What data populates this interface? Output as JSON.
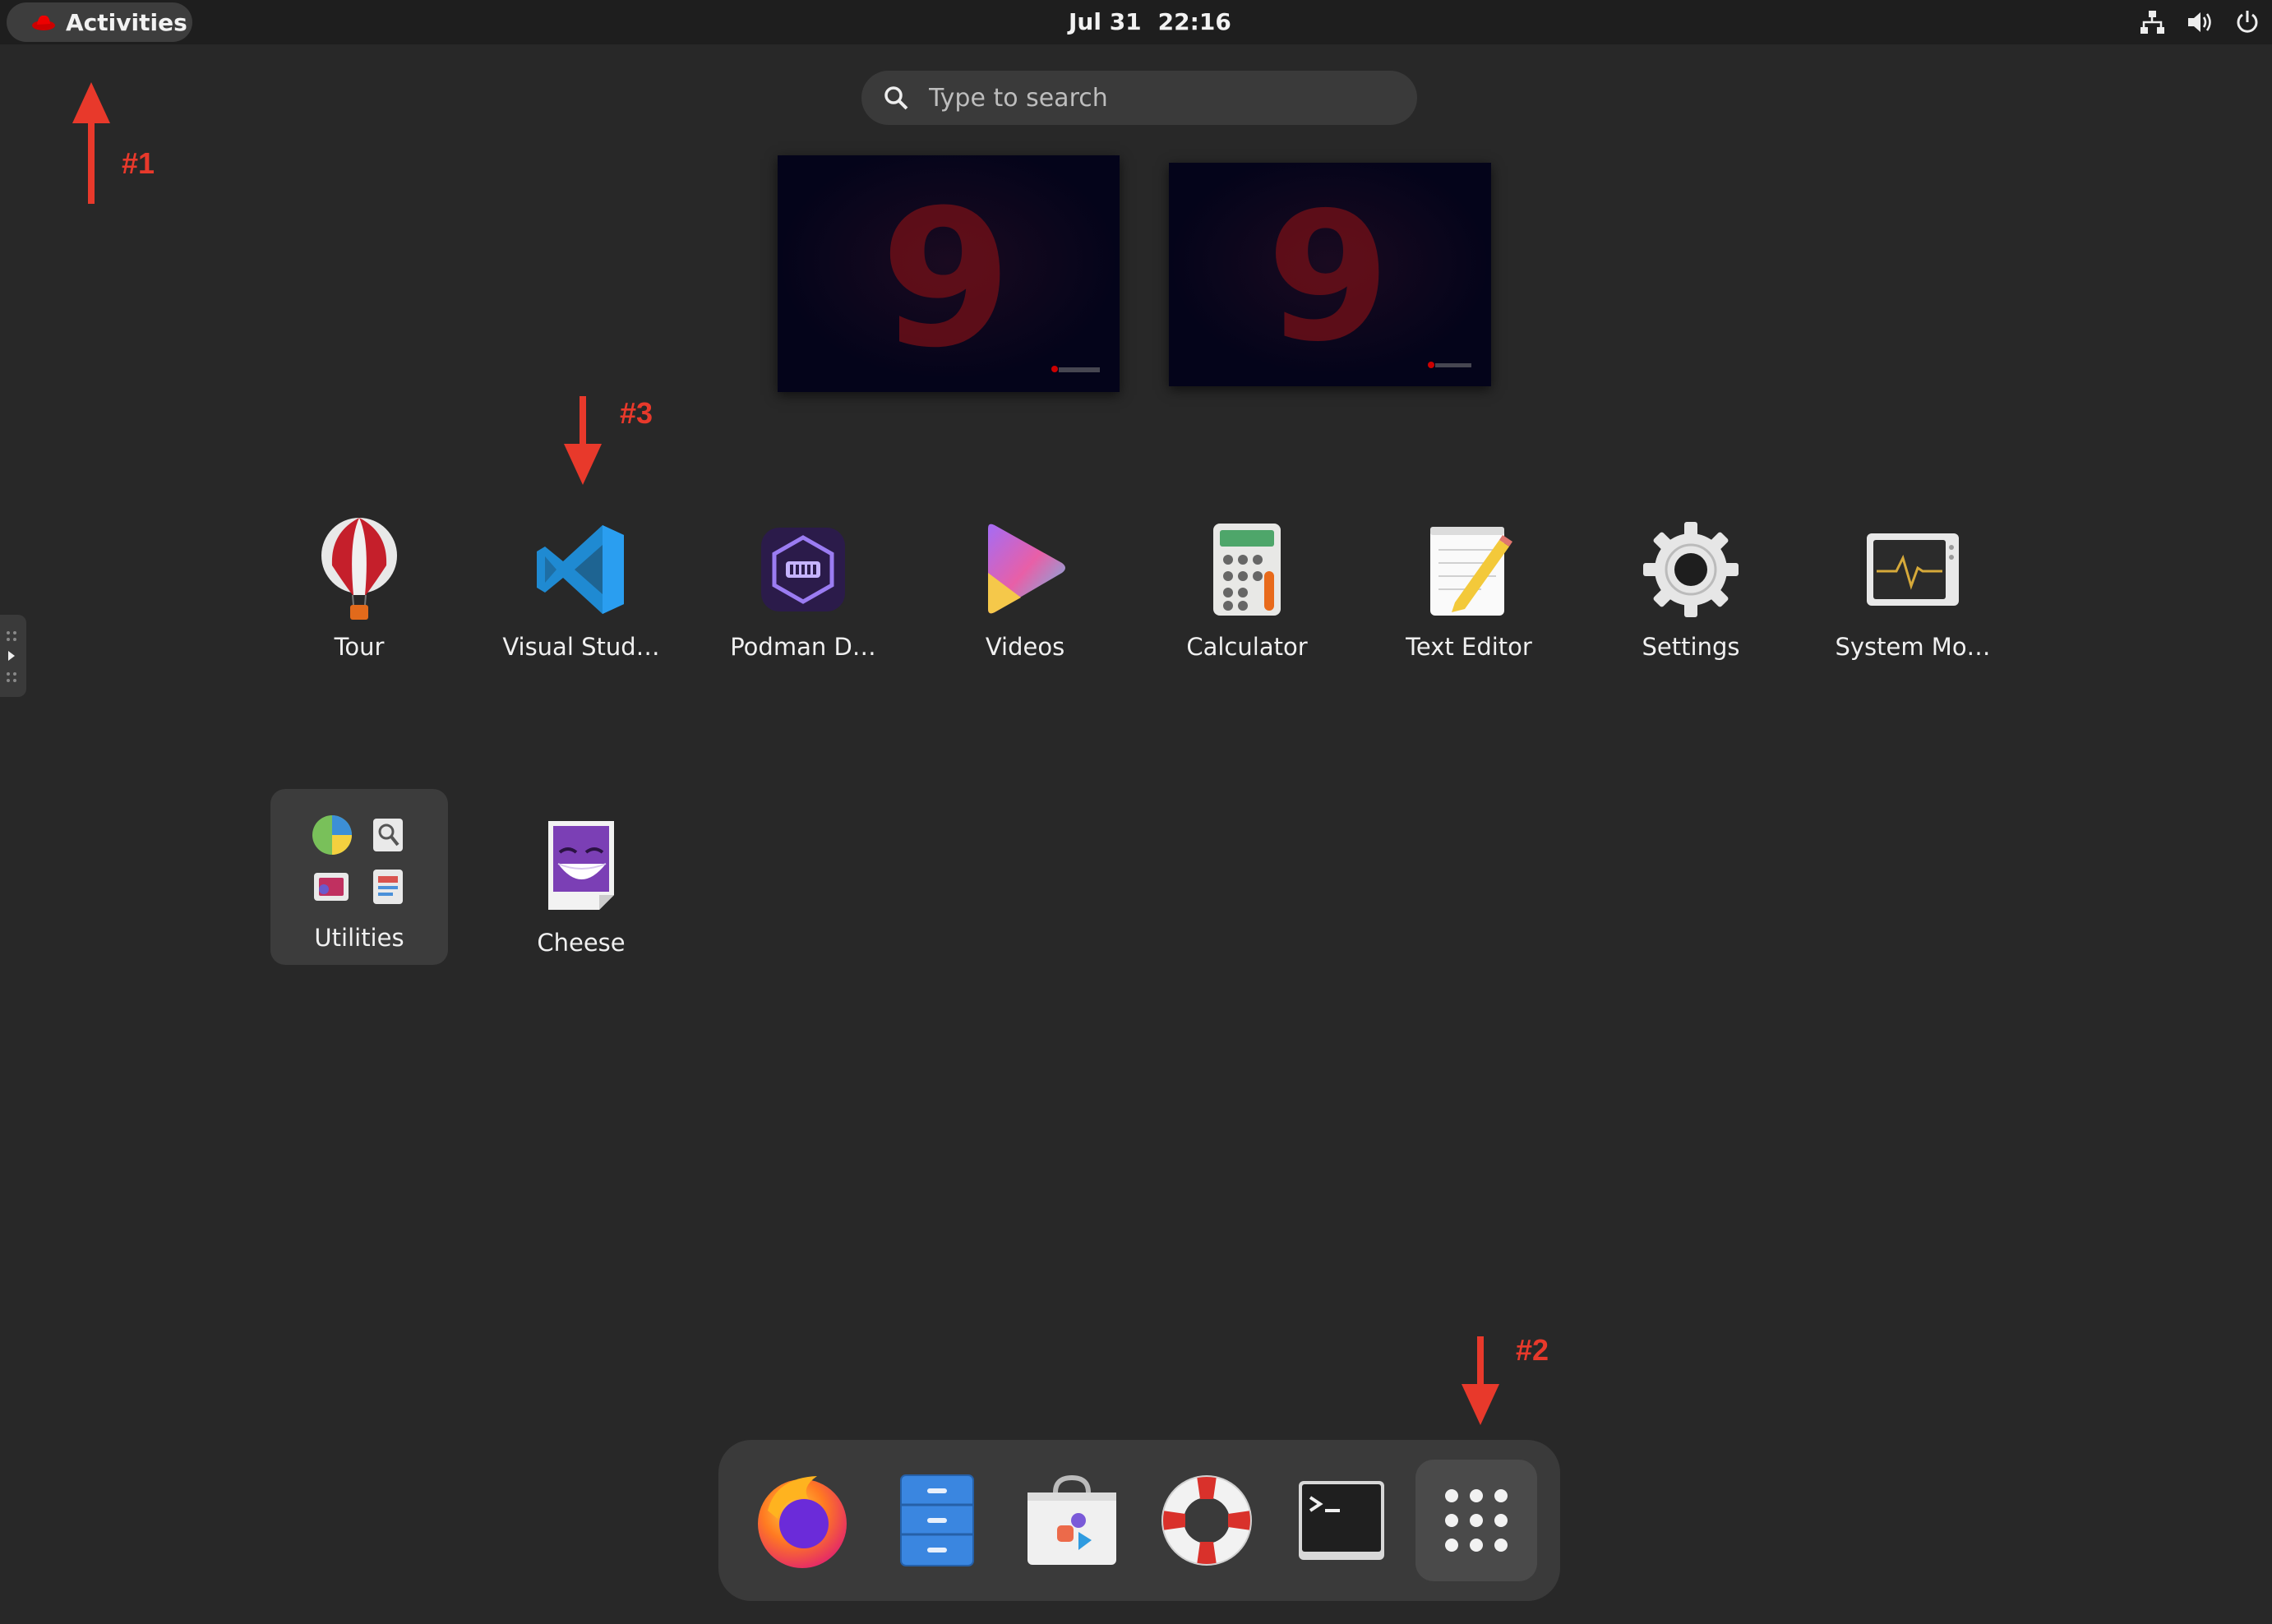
{
  "topbar": {
    "activities_label": "Activities",
    "date": "Jul 31",
    "time": "22:16",
    "tray_icons": [
      "network-icon",
      "volume-icon",
      "power-icon"
    ]
  },
  "search": {
    "placeholder": "Type to search"
  },
  "apps": [
    {
      "label": "Tour",
      "icon": "balloon-icon"
    },
    {
      "label": "Visual Stud…",
      "icon": "vscode-icon"
    },
    {
      "label": "Podman D…",
      "icon": "podman-icon"
    },
    {
      "label": "Videos",
      "icon": "videos-icon"
    },
    {
      "label": "Calculator",
      "icon": "calculator-icon"
    },
    {
      "label": "Text Editor",
      "icon": "text-editor-icon"
    },
    {
      "label": "Settings",
      "icon": "gear-icon"
    },
    {
      "label": "System Mo…",
      "icon": "system-monitor-icon"
    },
    {
      "label": "Utilities",
      "icon": "folder-icon"
    },
    {
      "label": "Cheese",
      "icon": "cheese-icon"
    }
  ],
  "dash": [
    {
      "name": "firefox",
      "icon": "firefox-icon"
    },
    {
      "name": "files",
      "icon": "files-icon"
    },
    {
      "name": "software",
      "icon": "software-icon"
    },
    {
      "name": "help",
      "icon": "lifebuoy-icon"
    },
    {
      "name": "terminal",
      "icon": "terminal-icon"
    },
    {
      "name": "show-apps",
      "icon": "app-grid-icon"
    }
  ],
  "annotations": [
    "#1",
    "#2",
    "#3"
  ],
  "workspace_glyph": "9",
  "colors": {
    "accent_red": "#e8392b",
    "background": "#282828",
    "topbar": "#1e1e1e"
  }
}
